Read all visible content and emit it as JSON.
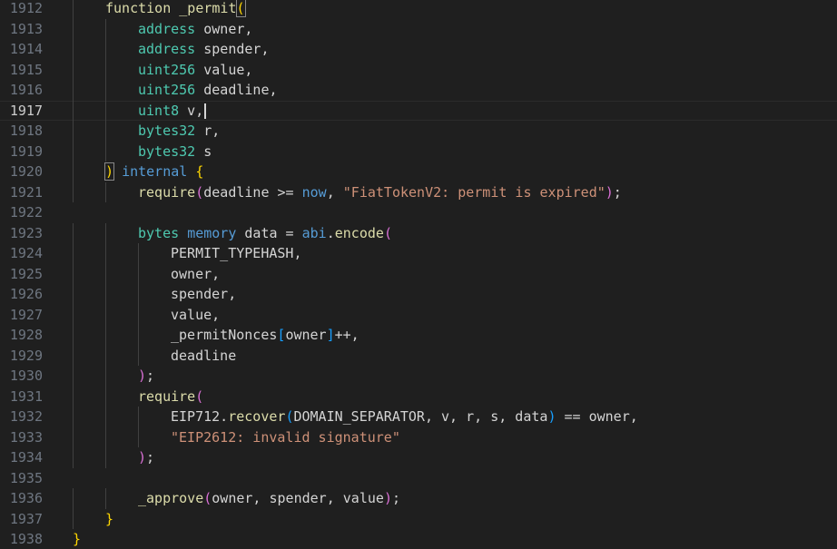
{
  "editor": {
    "active_line": "1917",
    "lines": [
      {
        "n": "1912",
        "tokens": [
          [
            "fn",
            "function"
          ],
          [
            "id",
            " "
          ],
          [
            "fn",
            "_permit"
          ],
          [
            "br1 brm",
            "("
          ]
        ]
      },
      {
        "n": "1913",
        "tokens": [
          [
            "ty",
            "address"
          ],
          [
            "id",
            " owner,"
          ]
        ]
      },
      {
        "n": "1914",
        "tokens": [
          [
            "ty",
            "address"
          ],
          [
            "id",
            " spender,"
          ]
        ]
      },
      {
        "n": "1915",
        "tokens": [
          [
            "ty",
            "uint256"
          ],
          [
            "id",
            " value,"
          ]
        ]
      },
      {
        "n": "1916",
        "tokens": [
          [
            "ty",
            "uint256"
          ],
          [
            "id",
            " deadline,"
          ]
        ]
      },
      {
        "n": "1917",
        "tokens": [
          [
            "ty",
            "uint8"
          ],
          [
            "id",
            " v,"
          ]
        ]
      },
      {
        "n": "1918",
        "tokens": [
          [
            "ty",
            "bytes32"
          ],
          [
            "id",
            " r,"
          ]
        ]
      },
      {
        "n": "1919",
        "tokens": [
          [
            "ty",
            "bytes32"
          ],
          [
            "id",
            " s"
          ]
        ]
      },
      {
        "n": "1920",
        "tokens": [
          [
            "br1 brm",
            ")"
          ],
          [
            "id",
            " "
          ],
          [
            "kw",
            "internal"
          ],
          [
            "id",
            " "
          ],
          [
            "br1",
            "{"
          ]
        ]
      },
      {
        "n": "1921",
        "tokens": [
          [
            "fn",
            "require"
          ],
          [
            "br2",
            "("
          ],
          [
            "id",
            "deadline >= "
          ],
          [
            "kw",
            "now"
          ],
          [
            "id",
            ", "
          ],
          [
            "str",
            "\"FiatTokenV2: permit is expired\""
          ],
          [
            "br2",
            ")"
          ],
          [
            "id",
            ";"
          ]
        ]
      },
      {
        "n": "1922",
        "tokens": []
      },
      {
        "n": "1923",
        "tokens": [
          [
            "ty",
            "bytes"
          ],
          [
            "id",
            " "
          ],
          [
            "kw",
            "memory"
          ],
          [
            "id",
            " data = "
          ],
          [
            "kw",
            "abi"
          ],
          [
            "id",
            "."
          ],
          [
            "fn",
            "encode"
          ],
          [
            "br2",
            "("
          ]
        ]
      },
      {
        "n": "1924",
        "tokens": [
          [
            "id",
            "PERMIT_TYPEHASH,"
          ]
        ]
      },
      {
        "n": "1925",
        "tokens": [
          [
            "id",
            "owner,"
          ]
        ]
      },
      {
        "n": "1926",
        "tokens": [
          [
            "id",
            "spender,"
          ]
        ]
      },
      {
        "n": "1927",
        "tokens": [
          [
            "id",
            "value,"
          ]
        ]
      },
      {
        "n": "1928",
        "tokens": [
          [
            "id",
            "_permitNonces"
          ],
          [
            "br3",
            "["
          ],
          [
            "id",
            "owner"
          ],
          [
            "br3",
            "]"
          ],
          [
            "id",
            "++,"
          ]
        ]
      },
      {
        "n": "1929",
        "tokens": [
          [
            "id",
            "deadline"
          ]
        ]
      },
      {
        "n": "1930",
        "tokens": [
          [
            "br2",
            ")"
          ],
          [
            "id",
            ";"
          ]
        ]
      },
      {
        "n": "1931",
        "tokens": [
          [
            "fn",
            "require"
          ],
          [
            "br2",
            "("
          ]
        ]
      },
      {
        "n": "1932",
        "tokens": [
          [
            "id",
            "EIP712."
          ],
          [
            "fn",
            "recover"
          ],
          [
            "br3",
            "("
          ],
          [
            "id",
            "DOMAIN_SEPARATOR, v, r, s, data"
          ],
          [
            "br3",
            ")"
          ],
          [
            "id",
            " == owner,"
          ]
        ]
      },
      {
        "n": "1933",
        "tokens": [
          [
            "str",
            "\"EIP2612: invalid signature\""
          ]
        ]
      },
      {
        "n": "1934",
        "tokens": [
          [
            "br2",
            ")"
          ],
          [
            "id",
            ";"
          ]
        ]
      },
      {
        "n": "1935",
        "tokens": []
      },
      {
        "n": "1936",
        "tokens": [
          [
            "fn",
            "_approve"
          ],
          [
            "br2",
            "("
          ],
          [
            "id",
            "owner, spender, value"
          ],
          [
            "br2",
            ")"
          ],
          [
            "id",
            ";"
          ]
        ]
      },
      {
        "n": "1937",
        "tokens": [
          [
            "br1",
            "}"
          ]
        ]
      },
      {
        "n": "1938",
        "tokens": [
          [
            "br1",
            "}"
          ]
        ]
      }
    ]
  }
}
